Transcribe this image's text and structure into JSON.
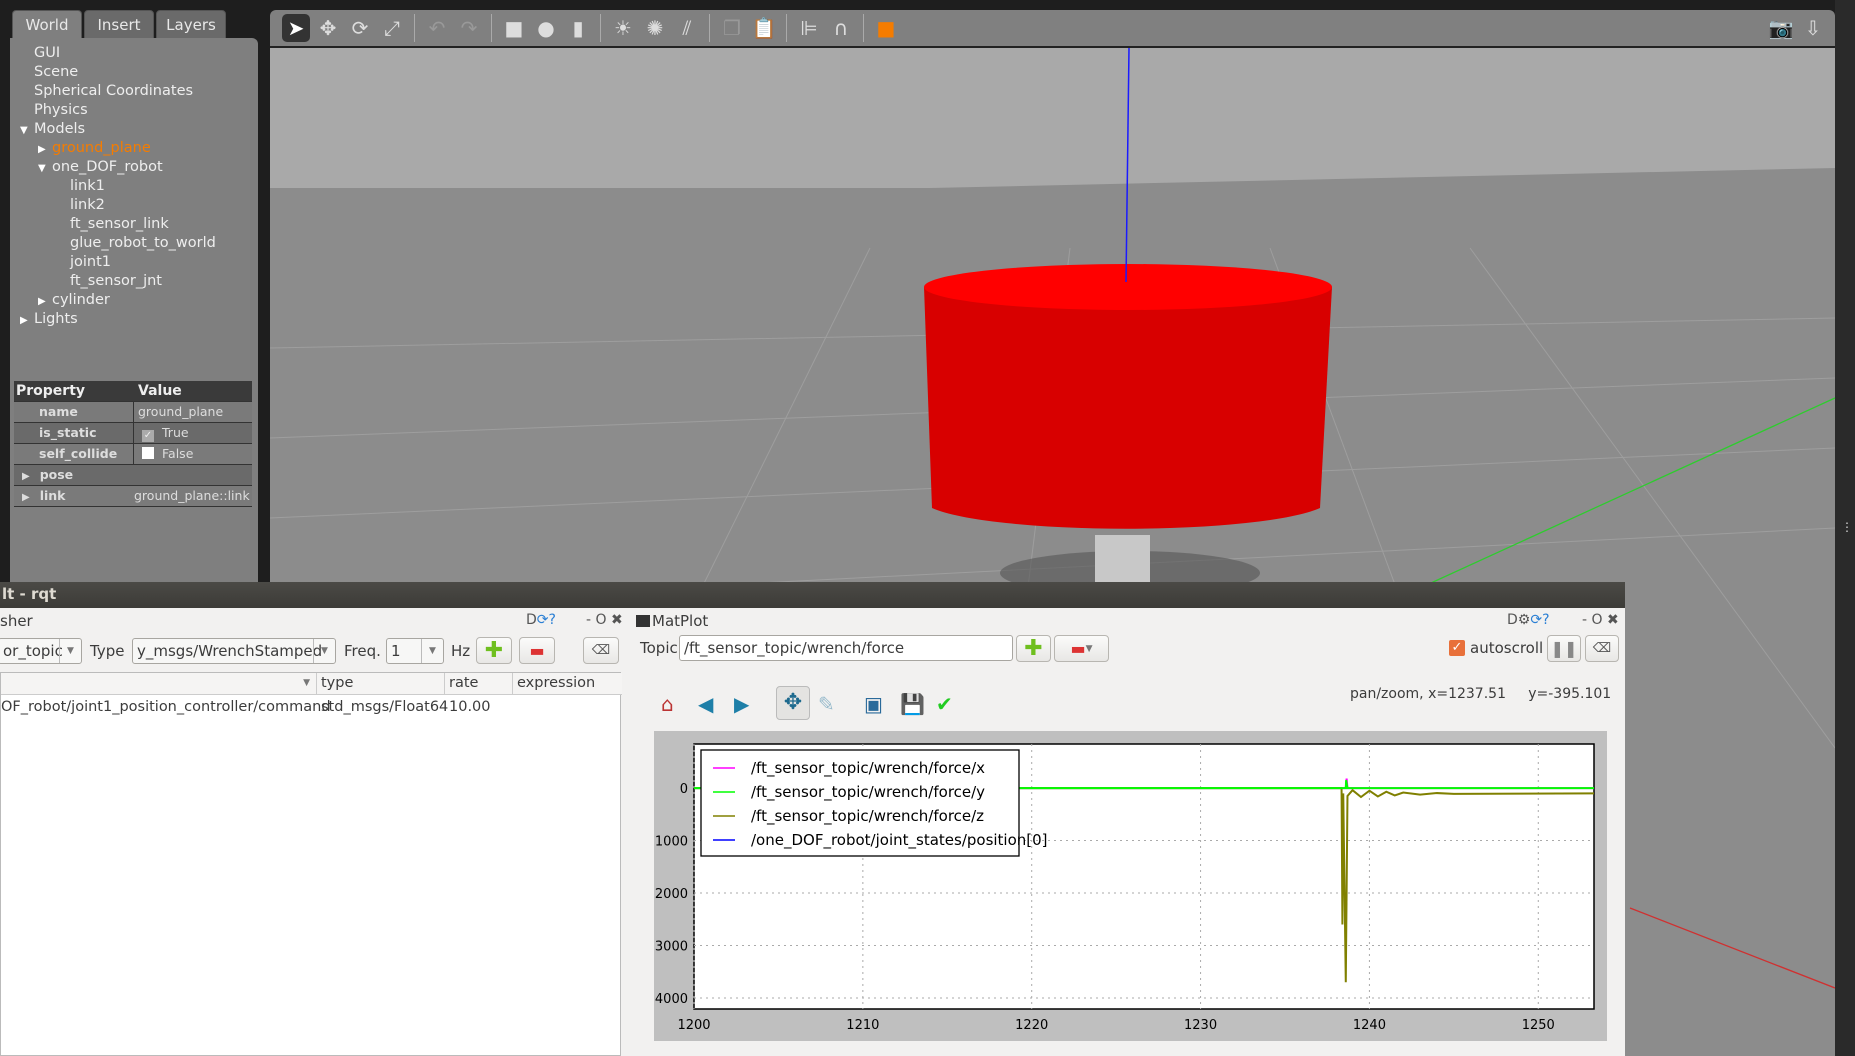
{
  "gazebo": {
    "tabs": [
      "World",
      "Insert",
      "Layers"
    ],
    "tree": [
      {
        "label": "GUI",
        "indent": 0,
        "arrow": ""
      },
      {
        "label": "Scene",
        "indent": 0,
        "arrow": ""
      },
      {
        "label": "Spherical Coordinates",
        "indent": 0,
        "arrow": ""
      },
      {
        "label": "Physics",
        "indent": 0,
        "arrow": ""
      },
      {
        "label": "Models",
        "indent": 0,
        "arrow": "down"
      },
      {
        "label": "ground_plane",
        "indent": 1,
        "arrow": "right",
        "selected": true
      },
      {
        "label": "one_DOF_robot",
        "indent": 1,
        "arrow": "down"
      },
      {
        "label": "link1",
        "indent": 2,
        "arrow": ""
      },
      {
        "label": "link2",
        "indent": 2,
        "arrow": ""
      },
      {
        "label": "ft_sensor_link",
        "indent": 2,
        "arrow": ""
      },
      {
        "label": "glue_robot_to_world",
        "indent": 2,
        "arrow": ""
      },
      {
        "label": "joint1",
        "indent": 2,
        "arrow": ""
      },
      {
        "label": "ft_sensor_jnt",
        "indent": 2,
        "arrow": ""
      },
      {
        "label": "cylinder",
        "indent": 1,
        "arrow": "right"
      },
      {
        "label": "Lights",
        "indent": 0,
        "arrow": "right"
      }
    ],
    "properties": {
      "header": [
        "Property",
        "Value"
      ],
      "rows": [
        {
          "name": "name",
          "value": "ground_plane",
          "check": null
        },
        {
          "name": "is_static",
          "value": "True",
          "check": true
        },
        {
          "name": "self_collide",
          "value": "False",
          "check": false
        },
        {
          "name": "pose",
          "value": "",
          "expand": true
        },
        {
          "name": "link",
          "value": "ground_plane::link",
          "expand": true
        }
      ]
    },
    "toolbar_icons": [
      "select-arrow-icon",
      "translate-icon",
      "rotate-icon",
      "scale-icon",
      "undo-icon",
      "redo-icon",
      "box-icon",
      "sphere-icon",
      "cylinder-icon",
      "point-light-icon",
      "spot-light-icon",
      "directional-light-icon",
      "copy-icon",
      "paste-icon",
      "align-icon",
      "magnet-icon",
      "view-angle-icon",
      "screenshot-icon",
      "log-icon"
    ],
    "accent": "#f57c00"
  },
  "rqt": {
    "title": "lt - rqt",
    "publisher": {
      "title": "sher",
      "topic": "or_topic",
      "type_label": "Type",
      "type_value": "y_msgs/WrenchStamped",
      "freq_label": "Freq.",
      "freq_value": "1",
      "hz_label": "Hz",
      "columns": [
        "",
        "type",
        "rate",
        "expression"
      ],
      "rows": [
        {
          "topic": "OF_robot/joint1_position_controller/command",
          "type": "std_msgs/Float64",
          "rate": "10.00",
          "expression": ""
        }
      ]
    },
    "matplot": {
      "title": "MatPlot",
      "topic_label": "Topic",
      "topic_value": "/ft_sensor_topic/wrench/force",
      "autoscroll_label": "autoscroll",
      "autoscroll": true,
      "status": "pan/zoom, x=1237.51     y=-395.101"
    },
    "window_controls": "- O ✖"
  },
  "chart_data": {
    "type": "line",
    "xlim": [
      1200,
      1253.3
    ],
    "ylim": [
      -4210,
      840
    ],
    "xticks": [
      1200,
      1210,
      1220,
      1230,
      1240,
      1250
    ],
    "xtick_labels": [
      "1200",
      "1210",
      "1220",
      "1230",
      "1240",
      "1250"
    ],
    "yticks": [
      0,
      -1000,
      -2000,
      -3000,
      -4000
    ],
    "ytick_labels": [
      "0",
      "1000",
      "2000",
      "3000",
      "4000"
    ],
    "grid": true,
    "legend_position": "top-left",
    "series": [
      {
        "name": "/ft_sensor_topic/wrench/force/x",
        "color": "#ff00ff",
        "points": [
          [
            1200,
            0
          ],
          [
            1238.6,
            0
          ],
          [
            1238.65,
            180
          ],
          [
            1238.7,
            0
          ],
          [
            1253.3,
            0
          ]
        ]
      },
      {
        "name": "/ft_sensor_topic/wrench/force/z",
        "color": "#808000",
        "points": [
          [
            1200,
            0
          ],
          [
            1238.35,
            0
          ],
          [
            1238.4,
            -2600
          ],
          [
            1238.45,
            -100
          ],
          [
            1238.6,
            -3700
          ],
          [
            1238.7,
            -150
          ],
          [
            1239,
            -40
          ],
          [
            1239.5,
            -170
          ],
          [
            1240,
            -50
          ],
          [
            1240.5,
            -160
          ],
          [
            1241,
            -70
          ],
          [
            1241.5,
            -140
          ],
          [
            1242,
            -85
          ],
          [
            1243,
            -125
          ],
          [
            1244,
            -95
          ],
          [
            1245,
            -110
          ],
          [
            1253.3,
            -100
          ]
        ]
      },
      {
        "name": "/ft_sensor_topic/wrench/force/y",
        "color": "#00ff00",
        "points": [
          [
            1200,
            0
          ],
          [
            1238.6,
            0
          ],
          [
            1238.62,
            150
          ],
          [
            1238.7,
            0
          ],
          [
            1253.3,
            0
          ]
        ]
      },
      {
        "name": "/one_DOF_robot/joint_states/position[0]",
        "color": "#0000ff",
        "points": []
      }
    ],
    "legend_order": [
      0,
      2,
      1,
      3
    ]
  }
}
